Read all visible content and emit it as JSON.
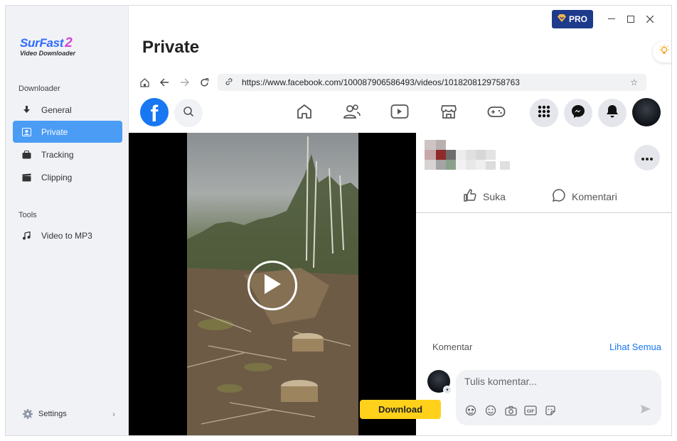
{
  "app": {
    "logo_main": "SurFast",
    "logo_num": "2",
    "logo_sub": "Video Downloader",
    "pro_label": "PRO"
  },
  "sidebar": {
    "downloader_title": "Downloader",
    "items": [
      {
        "label": "General",
        "icon": "download-arrow-icon"
      },
      {
        "label": "Private",
        "icon": "private-id-icon",
        "active": true
      },
      {
        "label": "Tracking",
        "icon": "tracking-icon"
      },
      {
        "label": "Clipping",
        "icon": "clapperboard-icon"
      }
    ],
    "tools_title": "Tools",
    "tools": [
      {
        "label": "Video to MP3",
        "icon": "music-note-icon"
      }
    ],
    "settings_label": "Settings"
  },
  "page": {
    "title": "Private"
  },
  "browser": {
    "url": "https://www.facebook.com/100087906586493/videos/1018208129758763"
  },
  "facebook": {
    "logo_letter": "f",
    "actions": {
      "like_label": "Suka",
      "comment_label": "Komentari"
    },
    "comments": {
      "header": "Komentar",
      "see_all": "Lihat Semua",
      "placeholder": "Tulis komentar...",
      "gif_label": "GIF"
    }
  },
  "download_label": "Download",
  "colors": {
    "accent": "#4a9cf4",
    "pro_bg": "#1e3a8a",
    "facebook_blue": "#1877f2",
    "download_yellow": "#ffd11a"
  }
}
